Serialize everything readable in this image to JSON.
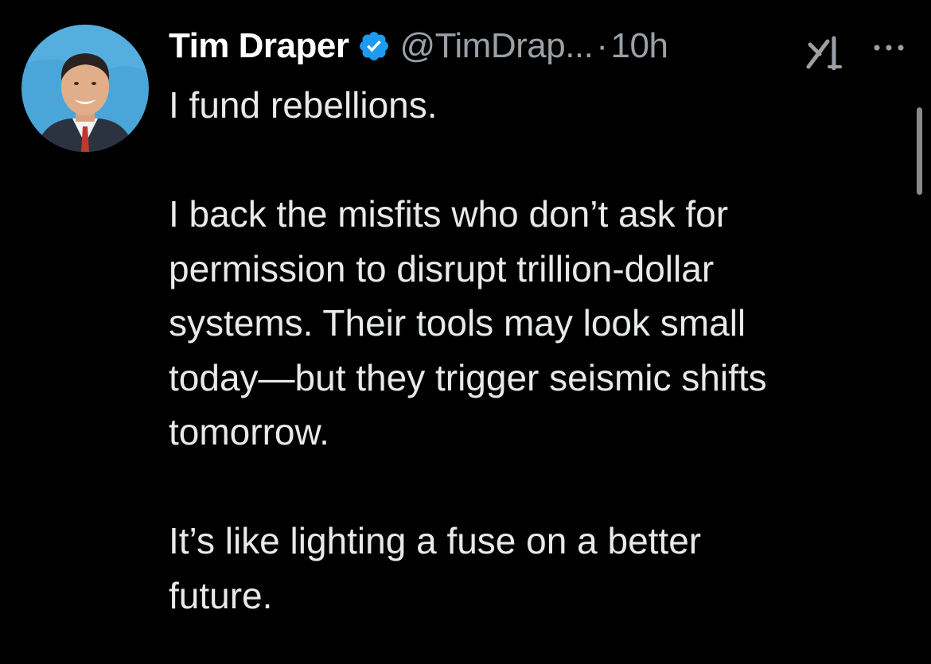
{
  "post": {
    "author": {
      "name": "Tim Draper",
      "handle": "@TimDrap...",
      "verified": true,
      "avatar_icon": "profile-photo",
      "verified_icon": "verified-badge-icon",
      "verified_color": "#1d9bf0"
    },
    "separator": "·",
    "time": "10h",
    "actions": {
      "grok_icon": "grok-icon",
      "more_icon": "more-icon"
    },
    "paragraphs": [
      {
        "lines": [
          "I fund rebellions."
        ]
      },
      {
        "lines": [
          "I back the misfits who don’t ask for",
          "permission to disrupt trillion-dollar",
          "systems. Their tools may look small",
          "today—but they trigger seismic shifts",
          "tomorrow."
        ]
      },
      {
        "lines": [
          "It’s like lighting a fuse on a better",
          "future."
        ]
      }
    ]
  },
  "theme": {
    "background": "#000000",
    "text": "#e7e9ea",
    "secondary": "#9aa0a6"
  }
}
